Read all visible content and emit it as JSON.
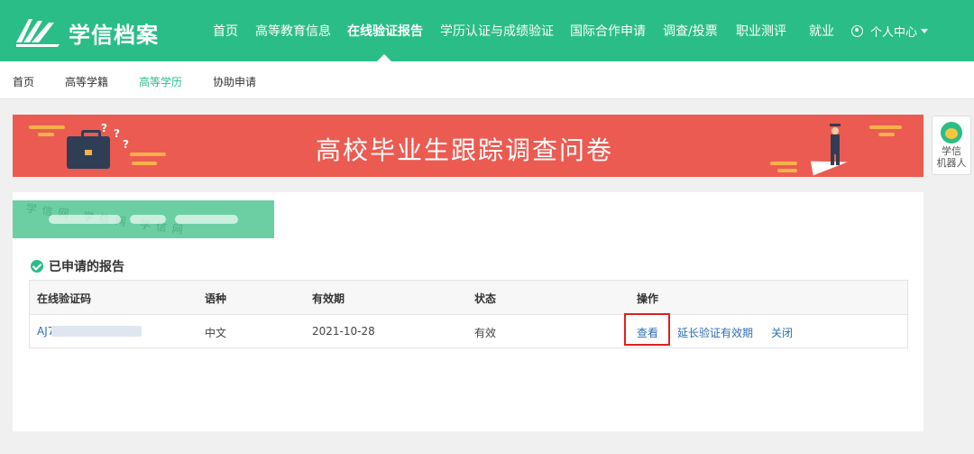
{
  "header": {
    "logo_text": "学信档案",
    "nav": [
      "首页",
      "高等教育信息",
      "在线验证报告",
      "学历认证与成绩验证",
      "国际合作申请",
      "调查/投票",
      "职业测评",
      "就业"
    ],
    "active_nav": "在线验证报告",
    "user_menu": "个人中心"
  },
  "subnav": {
    "items": [
      "首页",
      "高等学籍",
      "高等学历",
      "协助申请"
    ],
    "active": "高等学历"
  },
  "banner": {
    "title": "高校毕业生跟踪调查问卷",
    "qmarks": [
      "?",
      "?",
      "?"
    ]
  },
  "robot": {
    "line1": "学信",
    "line2": "机器人"
  },
  "watermark": {
    "text": "学信网 学信网 学信网"
  },
  "reports": {
    "title": "已申请的报告",
    "columns": [
      "在线验证码",
      "语种",
      "有效期",
      "状态",
      "操作"
    ],
    "rows": [
      {
        "code": "AJ7C",
        "language": "中文",
        "expiry": "2021-10-28",
        "status": "有效",
        "actions": [
          "查看",
          "延长验证有效期",
          "关闭"
        ]
      }
    ]
  },
  "colors": {
    "brand": "#2bbd88",
    "banner": "#ec5b52",
    "link": "#2c6fb8",
    "highlight": "#e02020"
  }
}
